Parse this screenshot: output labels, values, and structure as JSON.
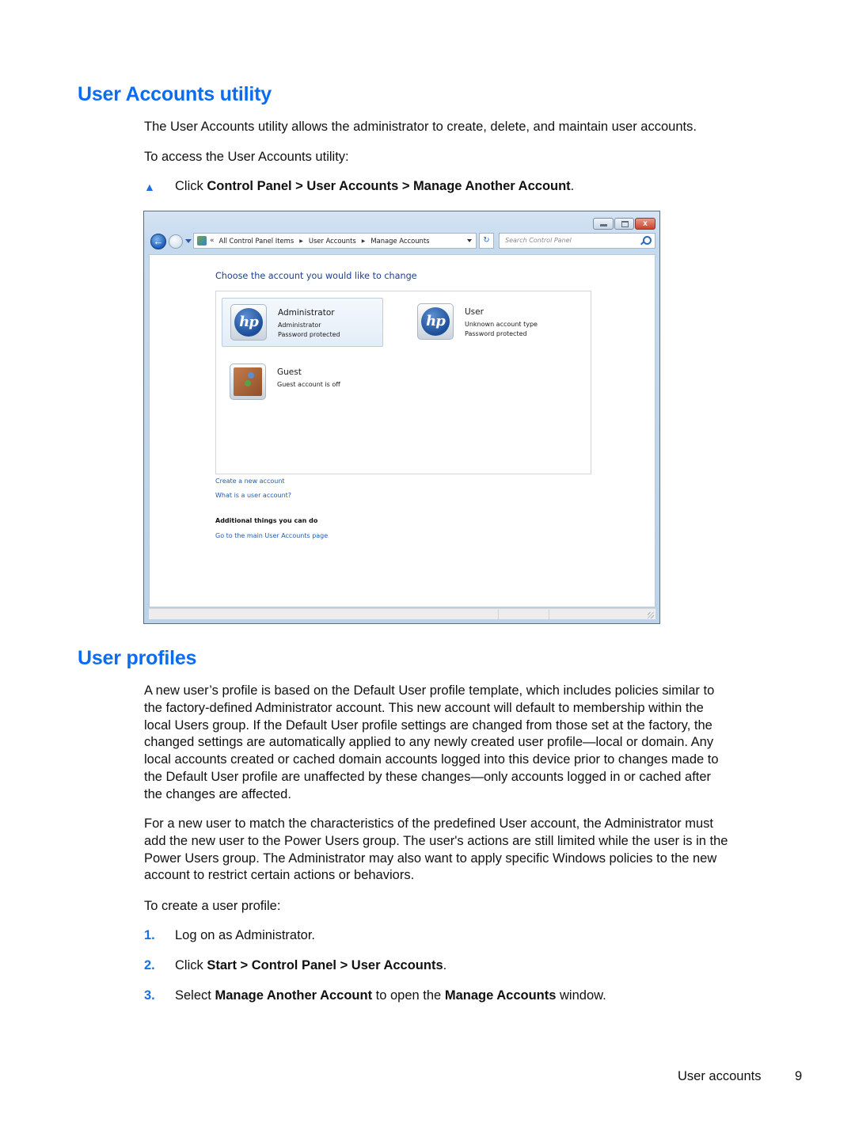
{
  "section1": {
    "heading": "User Accounts utility",
    "intro": "The User Accounts utility allows the administrator to create, delete, and maintain user accounts.",
    "access_label": "To access the User Accounts utility:",
    "bullet_glyph": "▲",
    "instruction": {
      "prefix": "Click ",
      "bold": "Control Panel > User Accounts > Manage Another Account",
      "suffix": "."
    }
  },
  "window": {
    "controls": {
      "close_glyph": "x"
    },
    "nav": {
      "back_glyph": "←"
    },
    "address": {
      "overflow_glyph": "«",
      "crumbs": [
        "All Control Panel Items",
        "User Accounts",
        "Manage Accounts"
      ],
      "separator_glyph": "▶"
    },
    "refresh_glyph": "↻",
    "search_placeholder": "Search Control Panel",
    "heading": "Choose the account you would like to change",
    "accounts": [
      {
        "name": "Administrator",
        "line1": "Administrator",
        "line2": "Password protected",
        "avatar": "hp-logo",
        "selected": true
      },
      {
        "name": "User",
        "line1": "Unknown account type",
        "line2": "Password protected",
        "avatar": "hp-logo",
        "selected": false
      },
      {
        "name": "Guest",
        "line1": "Guest account is off",
        "avatar": "suitcase"
      }
    ],
    "links": [
      "Create a new account",
      "What is a user account?"
    ],
    "additional_heading": "Additional things you can do",
    "additional_links": [
      "Go to the main User Accounts page"
    ],
    "hp_logo_text": "hp"
  },
  "section2": {
    "heading": "User profiles",
    "para1_lines": [
      "A new user’s profile is based on the Default User profile template, which includes policies similar to",
      "the factory-defined Administrator account. This new account will default to membership within the",
      "local Users group. If the Default User profile settings are changed from those set at the factory, the",
      "changed settings are automatically applied to any newly created user profile—local or domain. Any",
      "local accounts created or cached domain accounts logged into this device prior to changes made to",
      "the Default User profile are unaffected by these changes—only accounts logged in or cached after",
      "the changes are affected."
    ],
    "para2_lines": [
      "For a new user to match the characteristics of the predefined User account, the Administrator must",
      "add the new user to the Power Users group. The user's actions are still limited while the user is in the",
      "Power Users group. The Administrator may also want to apply specific Windows policies to the new",
      "account to restrict certain actions or behaviors."
    ],
    "create_label": "To create a user profile:",
    "steps": [
      {
        "num": "1.",
        "parts": [
          {
            "t": "Log on as Administrator.",
            "b": false
          }
        ]
      },
      {
        "num": "2.",
        "parts": [
          {
            "t": "Click ",
            "b": false
          },
          {
            "t": "Start > Control Panel > User Accounts",
            "b": true
          },
          {
            "t": ".",
            "b": false
          }
        ]
      },
      {
        "num": "3.",
        "parts": [
          {
            "t": "Select ",
            "b": false
          },
          {
            "t": "Manage Another Account",
            "b": true
          },
          {
            "t": " to open the ",
            "b": false
          },
          {
            "t": "Manage Accounts",
            "b": true
          },
          {
            "t": " window.",
            "b": false
          }
        ]
      }
    ]
  },
  "footer": {
    "section": "User accounts",
    "page": "9"
  },
  "colors": {
    "heading_blue": "#0a6cf0",
    "link_blue": "#1e5bb5"
  }
}
